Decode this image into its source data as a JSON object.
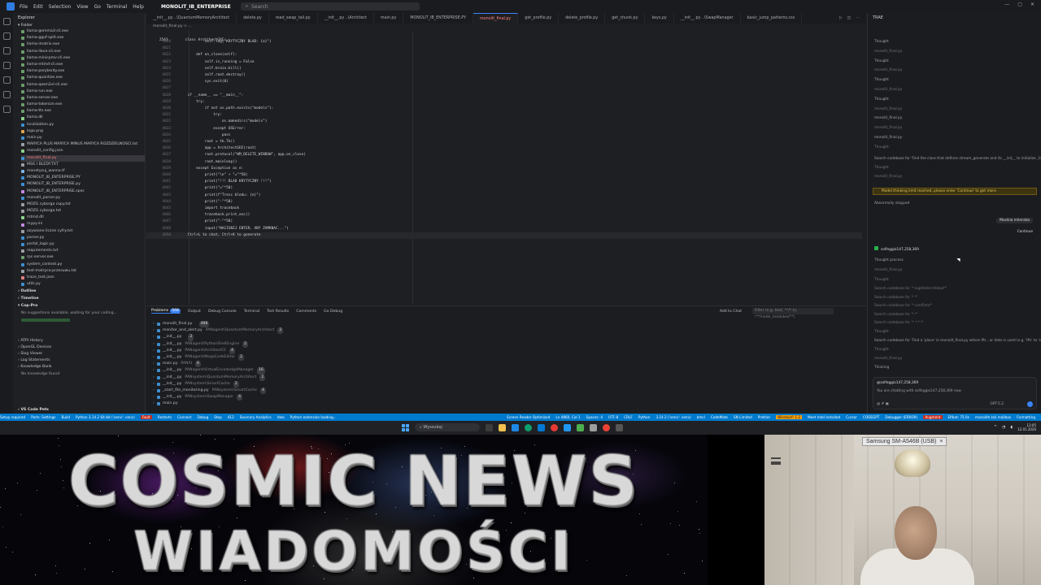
{
  "menubar": {
    "items": [
      "File",
      "Edit",
      "Selection",
      "View",
      "Go",
      "Terminal",
      "Help"
    ],
    "project": "MONOLIT_IB_ENTERPRISE",
    "search_placeholder": "Search"
  },
  "explorer": {
    "title": "Explorer",
    "folder": "Folder",
    "files": [
      "llama-gemma3-cli.exe",
      "llama-gguf-split.exe",
      "llama-imatrix.exe",
      "llama-llava-cli.exe",
      "llama-minicpmv-cli.exe",
      "llama-mtmd-cli.exe",
      "llama-perplexity.exe",
      "llama-quantize.exe",
      "llama-qwen2vl-cli.exe",
      "llama-run.exe",
      "llama-server.exe",
      "llama-tokenize.exe",
      "llama-tts.exe",
      "llama.dll",
      "localization.py",
      "logo.png",
      "main.py",
      "MARYCA PLUS MARYCA MINUS MARYCA ROZDZIELNOSCI.txt",
      "monolit_config.json",
      "monolit_final.py",
      "MSG I BLEDY.TXT",
      "monetyzuj_wanna.tf",
      "MONOLIT_IB_ENTERPRISE.PY",
      "MONOLIT_IB_ENTERPRISE.py",
      "MONOLIT_IB_ENTERPRISE.spec",
      "monolit_parser.py",
      "MOZG cyborga copy.txt",
      "MOZG cyborga.txt",
      "mtmd.dll",
      "mypy.ini",
      "ozywione liczne cyfry.txt",
      "parser.py",
      "portal_logic.py",
      "requirements.txt",
      "rpc-server.exe",
      "system_context.py",
      "test-matryca-przesuwu.txt",
      "trace_test.json",
      "utils.py"
    ],
    "active_file": "monolit_final.py",
    "outline": "Outline",
    "timeline": "Timeline",
    "copro_title": "Cop-Pro",
    "copro_note": "No suggestions available, waiting for your coding...",
    "copro_status": "Analyzing...",
    "bottom_sections": [
      "ATPI History",
      "OpenGL Devices",
      "Slog Viewer",
      "Log Statements",
      "Knowledge Bank"
    ],
    "knowledge_note": "No knowledge found",
    "vscode_pets": "VS Code Pets"
  },
  "tabs": [
    "__init__.py  ..\\QuantumMemoryArchitect",
    "delete.py",
    "read_swap_tail.py",
    "__init__.py  ..\\Architect",
    "main.py",
    "MONOLIT_IB_ENTERPRISE.PY",
    "monolit_final.py",
    "get_profile.py",
    "delete_profile.py",
    "get_chunk.py",
    "keys.py",
    "__init__.py  ..\\SwapManager",
    "basic_jump_patterns.css"
  ],
  "active_tab_index": 6,
  "breadcrumb": "monolit_final.py  >  ...",
  "code": {
    "header_line": "2543        class ArchitectGUI:",
    "lines": [
      {
        "n": "4820",
        "t": "            self.log(\"KRYTYCZNY BLAD: {e}\")"
      },
      {
        "n": "4821",
        "t": ""
      },
      {
        "n": "4822",
        "t": "        def on_close(self):"
      },
      {
        "n": "4823",
        "t": "            self.is_running = False"
      },
      {
        "n": "4824",
        "t": "            self.brain.kill()"
      },
      {
        "n": "4825",
        "t": "            self.root.destroy()"
      },
      {
        "n": "4826",
        "t": "            sys.exit(0)"
      },
      {
        "n": "4827",
        "t": ""
      },
      {
        "n": "4828",
        "t": "    if __name__ == \"__main__\":"
      },
      {
        "n": "4829",
        "t": "        try:"
      },
      {
        "n": "4830",
        "t": "            if not os.path.exists(\"models\"):"
      },
      {
        "n": "4831",
        "t": "                try:"
      },
      {
        "n": "4832",
        "t": "                    os.makedirs(\"models\")"
      },
      {
        "n": "4833",
        "t": "                except OSError:"
      },
      {
        "n": "4834",
        "t": "                    pass"
      },
      {
        "n": "4835",
        "t": "            root = tk.Tk()"
      },
      {
        "n": "4836",
        "t": "            app = ArchitectGUI(root)"
      },
      {
        "n": "4837",
        "t": "            root.protocol(\"WM_DELETE_WINDOW\", app.on_close)"
      },
      {
        "n": "4838",
        "t": "            root.mainloop()"
      },
      {
        "n": "4839",
        "t": "        except Exception as e:"
      },
      {
        "n": "4840",
        "t": "            print(\"\\n\" + \"=\"*50)"
      },
      {
        "n": "4841",
        "t": "            print(\"!!! BLAD KRYTYCZNY !!!\")"
      },
      {
        "n": "4842",
        "t": "            print(\"=\"*50)"
      },
      {
        "n": "4843",
        "t": "            print(f\"Tresc bledu: {e}\")"
      },
      {
        "n": "4844",
        "t": "            print(\"-\"*50)"
      },
      {
        "n": "4845",
        "t": "            import traceback"
      },
      {
        "n": "4846",
        "t": "            traceback.print_exc()"
      },
      {
        "n": "4847",
        "t": "            print(\"-\"*50)"
      },
      {
        "n": "4848",
        "t": "            input(\"NACISNIJ ENTER, ABY ZAMKNAC...\")"
      },
      {
        "n": "4850",
        "t": "    Ctrl+L to chat, Ctrl+K to generate"
      }
    ]
  },
  "panel": {
    "tabs": [
      "Problems",
      "Output",
      "Debug Console",
      "Terminal",
      "Test Results",
      "Comments",
      "Go Debug"
    ],
    "problems_count": "568",
    "add_to_chat": "Add to Chat",
    "filter_placeholder": "Filter (e.g. text, **/*.ts, !**/node_modules/**)",
    "problems": [
      {
        "file": "monolit_final.py",
        "path": "",
        "count": "488"
      },
      {
        "file": "monitor_and_alert.py",
        "path": "PANagent\\QuantumMemoryArchitect",
        "count": "2"
      },
      {
        "file": "__init__.py",
        "path": "",
        "count": "2"
      },
      {
        "file": "__init__.py",
        "path": "PANagent\\PythonShellEngine",
        "count": "2"
      },
      {
        "file": "__init__.py",
        "path": "PANagent\\ArchitectCE",
        "count": "4"
      },
      {
        "file": "__init__.py",
        "path": "PANagent\\MegaCodeEditor",
        "count": "2"
      },
      {
        "file": "main.py",
        "path": "PANAI",
        "count": "6"
      },
      {
        "file": "__init__.py",
        "path": "PANagent\\VirtualEncodedgeManager",
        "count": "16"
      },
      {
        "file": "__init__.py",
        "path": "PANsystem\\QuantumMemoryArchitect",
        "count": "2"
      },
      {
        "file": "__init__.py",
        "path": "PANsystem\\SmartCache",
        "count": "2"
      },
      {
        "file": "_start_file_monitoring.py",
        "path": "PANsystem\\SmartCache",
        "count": "4"
      },
      {
        "file": "__init__.py",
        "path": "PANsystem\\SwapManager",
        "count": "4"
      },
      {
        "file": "main.py",
        "path": "",
        "count": ""
      }
    ]
  },
  "agent": {
    "title": "TRAE",
    "thought_items": [
      "Thought",
      "monolit_final.py",
      "Thought",
      "monolit_final.py",
      "Thought",
      "monolit_final.py",
      "Thought",
      "monolit_final.py",
      "monolit_final.py",
      "monolit_final.py",
      "monolit_final.py",
      "Thought"
    ],
    "search_line_1": "Search codebase for 'Find the class that defines stream_generate and its __init__ to initialize _llm_tool_lo...'",
    "thought_a": "Thought",
    "monolit_a": "monolit_final.py",
    "warning": "Model thinking limit reached, please enter 'Continue' to get more.",
    "abnormal": "Abnormally stopped",
    "user_msg_label": "Musikia milenska",
    "continue_label": "Continue",
    "user_name": "solfeggio147,258,369",
    "thought_process": "Thought process",
    "search_lines": [
      "Search codebase for '*.log/stderr/stdout*'",
      "Search codebase for '*.*'",
      "Search codebase for '*.conflicts*'",
      "Search codebase for '*.*'",
      "Search codebase for '*.*-*.*'"
    ],
    "search_line_2": "Search codebase for 'Find a 'place' in monolit_final.py where IPs , or data is used (e.g. 'IPs' to 'some' sc...'",
    "thinking": "Thinking",
    "chat_context": "@solfeggio147,258,369",
    "chat_hint": "You are chatting with solfeggio147,258,369 now",
    "model": "GPT-5.2"
  },
  "statusbar": {
    "left": [
      "Setup required",
      "Ports: Settings",
      "Build",
      "Python 3.14.2 64-bit ('venv': venv)",
      "Fault",
      "Restarts",
      "Connect",
      "Debug",
      "Stop",
      "412",
      "Sourcery Analytics",
      "Idea",
      "Python extension loading..."
    ],
    "right": [
      "Screen Reader Optimized",
      "Ln 4860, Col 1",
      "Spaces: 4",
      "UTF-8",
      "CRLF",
      "Python",
      "3.14.2 ('venv': venv)",
      "bmcl",
      "CodeMate",
      "SN Limited",
      "Prettier",
      "Windsurf: 1.2",
      "Meet Intel Installed",
      "Cursor",
      "CODEGPT",
      "Debugger (ERROR)",
      "Augment",
      "Elfbot: 75.0s",
      "monolith.tail.mailbox",
      "Formatting"
    ]
  },
  "taskbar": {
    "search_placeholder": "Wyszukaj",
    "time": "13:05",
    "date": "12.01.2026"
  },
  "overlay": {
    "headline": "COSMIC NEWS",
    "subline": "WIADOMOŚCI",
    "camera_label": "Samsung SM-A546B (USB)",
    "camera_close": "×"
  },
  "colors": {
    "accent": "#007acc",
    "active_file": "#ff7b7b",
    "warning": "#e6c75a"
  }
}
